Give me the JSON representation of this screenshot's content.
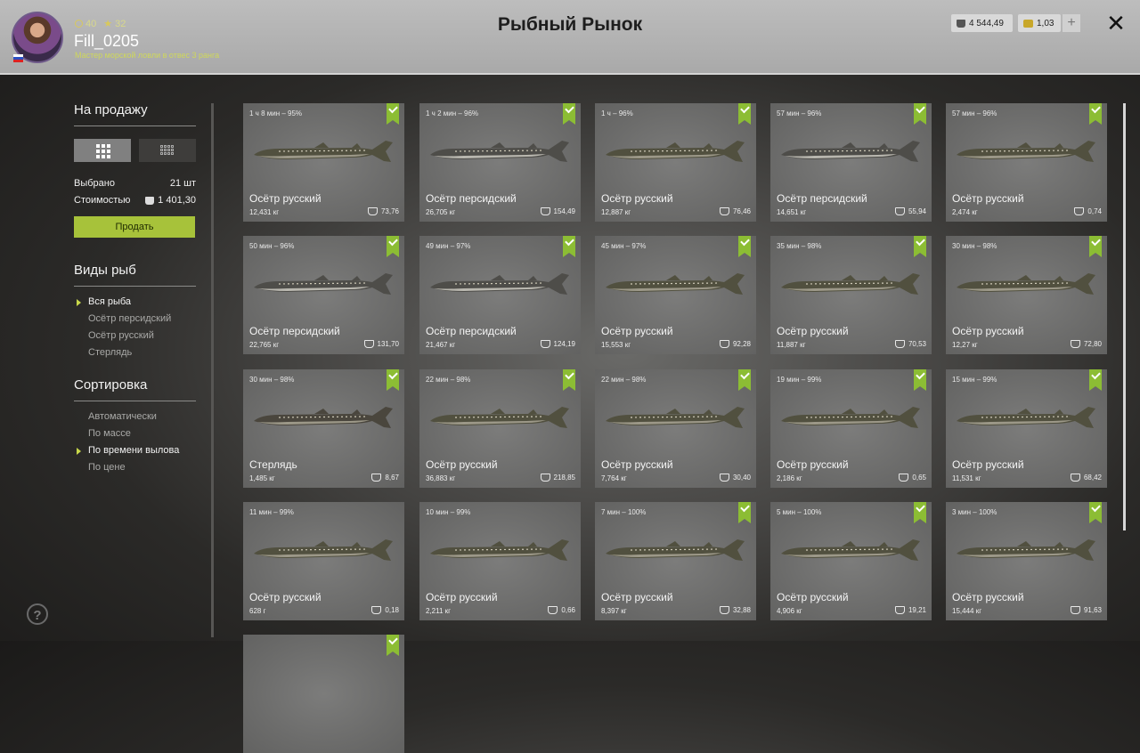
{
  "header": {
    "player": {
      "coins": "40",
      "stars": "32",
      "name": "Fill_0205",
      "rank": "Мастер морской ловли в отвес 3 ранга"
    },
    "title": "Рыбный Рынок",
    "currency": {
      "silver": "4 544,49",
      "gold": "1,03"
    },
    "plus_label": "+",
    "close_label": "✕"
  },
  "sidebar": {
    "sale_heading": "На продажу",
    "selected_label": "Выбрано",
    "selected_value": "21 шт",
    "cost_label": "Стоимостью",
    "cost_value": "1 401,30",
    "sell_button": "Продать",
    "species_heading": "Виды рыб",
    "species": [
      "Вся рыба",
      "Осётр персидский",
      "Осётр русский",
      "Стерлядь"
    ],
    "species_active": 0,
    "sort_heading": "Сортировка",
    "sort": [
      "Автоматически",
      "По массе",
      "По времени вылова",
      "По цене"
    ],
    "sort_active": 2,
    "help_label": "?"
  },
  "fish_cards": [
    {
      "time": "1 ч 8 мин – 95%",
      "name": "Осётр русский",
      "weight": "12,431 кг",
      "price": "73,76",
      "checked": true,
      "kind": "ru"
    },
    {
      "time": "1 ч 2 мин – 96%",
      "name": "Осётр персидский",
      "weight": "26,705 кг",
      "price": "154,49",
      "checked": true,
      "kind": "pe"
    },
    {
      "time": "1 ч – 96%",
      "name": "Осётр русский",
      "weight": "12,887 кг",
      "price": "76,46",
      "checked": true,
      "kind": "ru"
    },
    {
      "time": "57 мин – 96%",
      "name": "Осётр персидский",
      "weight": "14,651 кг",
      "price": "55,94",
      "checked": true,
      "kind": "pe"
    },
    {
      "time": "57 мин – 96%",
      "name": "Осётр русский",
      "weight": "2,474 кг",
      "price": "0,74",
      "checked": true,
      "kind": "ru"
    },
    {
      "time": "50 мин – 96%",
      "name": "Осётр персидский",
      "weight": "22,765 кг",
      "price": "131,70",
      "checked": true,
      "kind": "pe"
    },
    {
      "time": "49 мин – 97%",
      "name": "Осётр персидский",
      "weight": "21,467 кг",
      "price": "124,19",
      "checked": true,
      "kind": "pe"
    },
    {
      "time": "45 мин – 97%",
      "name": "Осётр русский",
      "weight": "15,553 кг",
      "price": "92,28",
      "checked": true,
      "kind": "ru"
    },
    {
      "time": "35 мин – 98%",
      "name": "Осётр русский",
      "weight": "11,887 кг",
      "price": "70,53",
      "checked": true,
      "kind": "ru"
    },
    {
      "time": "30 мин – 98%",
      "name": "Осётр русский",
      "weight": "12,27 кг",
      "price": "72,80",
      "checked": true,
      "kind": "ru"
    },
    {
      "time": "30 мин – 98%",
      "name": "Стерлядь",
      "weight": "1,485 кг",
      "price": "8,67",
      "checked": true,
      "kind": "st"
    },
    {
      "time": "22 мин – 98%",
      "name": "Осётр русский",
      "weight": "36,883 кг",
      "price": "218,85",
      "checked": true,
      "kind": "ru"
    },
    {
      "time": "22 мин – 98%",
      "name": "Осётр русский",
      "weight": "7,764 кг",
      "price": "30,40",
      "checked": true,
      "kind": "ru"
    },
    {
      "time": "19 мин – 99%",
      "name": "Осётр русский",
      "weight": "2,186 кг",
      "price": "0,65",
      "checked": true,
      "kind": "ru"
    },
    {
      "time": "15 мин – 99%",
      "name": "Осётр русский",
      "weight": "11,531 кг",
      "price": "68,42",
      "checked": true,
      "kind": "ru"
    },
    {
      "time": "11 мин – 99%",
      "name": "Осётр русский",
      "weight": "628 г",
      "price": "0,18",
      "checked": false,
      "kind": "ru"
    },
    {
      "time": "10 мин – 99%",
      "name": "Осётр русский",
      "weight": "2,211 кг",
      "price": "0,66",
      "checked": false,
      "kind": "ru"
    },
    {
      "time": "7 мин – 100%",
      "name": "Осётр русский",
      "weight": "8,397 кг",
      "price": "32,88",
      "checked": true,
      "kind": "ru"
    },
    {
      "time": "5 мин – 100%",
      "name": "Осётр русский",
      "weight": "4,906 кг",
      "price": "19,21",
      "checked": true,
      "kind": "ru"
    },
    {
      "time": "3 мин – 100%",
      "name": "Осётр русский",
      "weight": "15,444 кг",
      "price": "91,63",
      "checked": true,
      "kind": "ru"
    },
    {
      "time": "",
      "name": "",
      "weight": "",
      "price": "",
      "checked": true,
      "kind": "none"
    }
  ]
}
